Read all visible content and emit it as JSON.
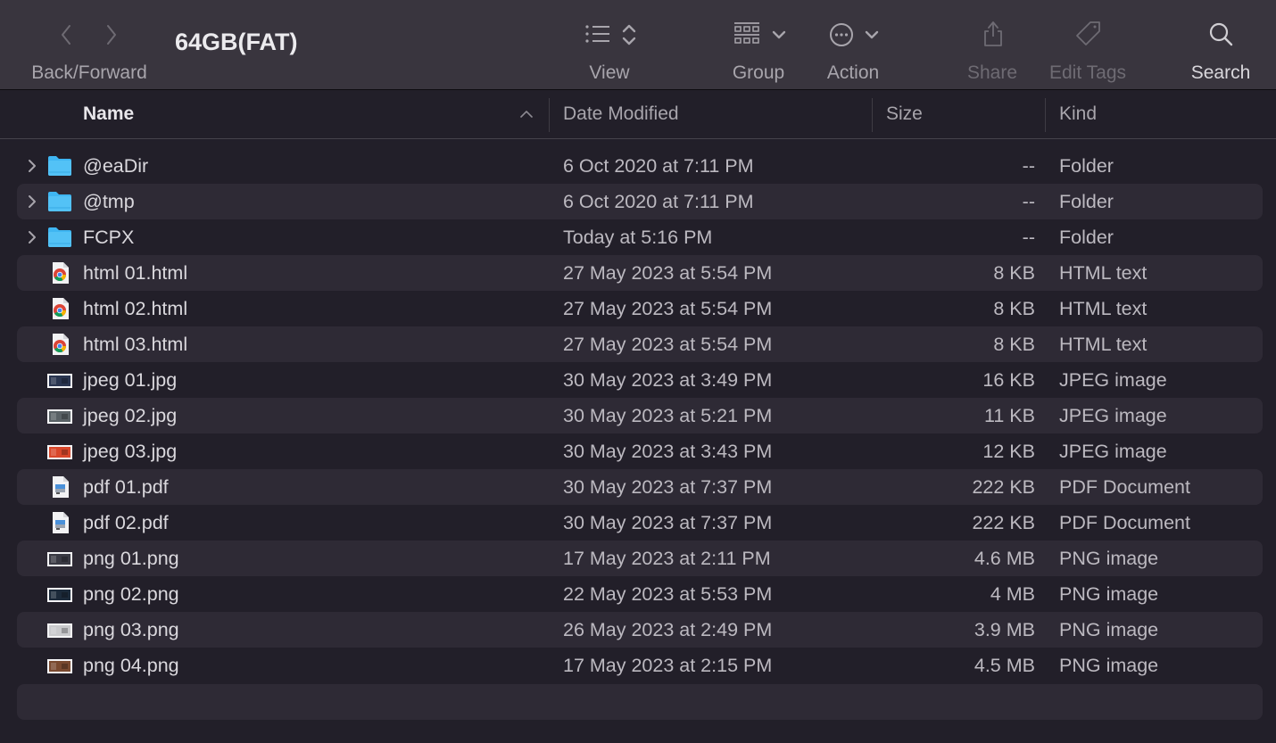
{
  "window": {
    "title": "64GB(FAT)"
  },
  "toolbar": {
    "back_forward_label": "Back/Forward",
    "view_label": "View",
    "group_label": "Group",
    "action_label": "Action",
    "share_label": "Share",
    "edit_tags_label": "Edit Tags",
    "search_label": "Search"
  },
  "columns": {
    "name": "Name",
    "date_modified": "Date Modified",
    "size": "Size",
    "kind": "Kind",
    "sort_indicator": "ascending"
  },
  "files": [
    {
      "name": "@eaDir",
      "date": "6 Oct 2020 at 7:11 PM",
      "size": "--",
      "kind": "Folder",
      "icon": "folder-icon",
      "expandable": true
    },
    {
      "name": "@tmp",
      "date": "6 Oct 2020 at 7:11 PM",
      "size": "--",
      "kind": "Folder",
      "icon": "folder-icon",
      "expandable": true
    },
    {
      "name": "FCPX",
      "date": "Today at 5:16 PM",
      "size": "--",
      "kind": "Folder",
      "icon": "folder-icon",
      "expandable": true
    },
    {
      "name": "html 01.html",
      "date": "27 May 2023 at 5:54 PM",
      "size": "8 KB",
      "kind": "HTML text",
      "icon": "chrome-html-icon",
      "expandable": false
    },
    {
      "name": "html 02.html",
      "date": "27 May 2023 at 5:54 PM",
      "size": "8 KB",
      "kind": "HTML text",
      "icon": "chrome-html-icon",
      "expandable": false
    },
    {
      "name": "html 03.html",
      "date": "27 May 2023 at 5:54 PM",
      "size": "8 KB",
      "kind": "HTML text",
      "icon": "chrome-html-icon",
      "expandable": false
    },
    {
      "name": "jpeg 01.jpg",
      "date": "30 May 2023 at 3:49 PM",
      "size": "16 KB",
      "kind": "JPEG image",
      "icon": "image-thumbnail-icon",
      "thumb": "#2a3550",
      "expandable": false
    },
    {
      "name": "jpeg 02.jpg",
      "date": "30 May 2023 at 5:21 PM",
      "size": "11 KB",
      "kind": "JPEG image",
      "icon": "image-thumbnail-icon",
      "thumb": "#5a6266",
      "expandable": false
    },
    {
      "name": "jpeg 03.jpg",
      "date": "30 May 2023 at 3:43 PM",
      "size": "12 KB",
      "kind": "JPEG image",
      "icon": "image-thumbnail-icon",
      "thumb": "#d9472b",
      "expandable": false
    },
    {
      "name": "pdf 01.pdf",
      "date": "30 May 2023 at 7:37 PM",
      "size": "222 KB",
      "kind": "PDF Document",
      "icon": "pdf-document-icon",
      "expandable": false
    },
    {
      "name": "pdf 02.pdf",
      "date": "30 May 2023 at 7:37 PM",
      "size": "222 KB",
      "kind": "PDF Document",
      "icon": "pdf-document-icon",
      "expandable": false
    },
    {
      "name": "png 01.png",
      "date": "17 May 2023 at 2:11 PM",
      "size": "4.6 MB",
      "kind": "PNG image",
      "icon": "image-thumbnail-icon",
      "thumb": "#3a3a44",
      "expandable": false
    },
    {
      "name": "png 02.png",
      "date": "22 May 2023 at 5:53 PM",
      "size": "4 MB",
      "kind": "PNG image",
      "icon": "image-thumbnail-icon",
      "thumb": "#1c2a3a",
      "expandable": false
    },
    {
      "name": "png 03.png",
      "date": "26 May 2023 at 2:49 PM",
      "size": "3.9 MB",
      "kind": "PNG image",
      "icon": "image-thumbnail-icon",
      "thumb": "#c9c9cc",
      "expandable": false
    },
    {
      "name": "png 04.png",
      "date": "17 May 2023 at 2:15 PM",
      "size": "4.5 MB",
      "kind": "PNG image",
      "icon": "image-thumbnail-icon",
      "thumb": "#7a4a30",
      "expandable": false
    }
  ],
  "colors": {
    "toolbar_bg": "#39353e",
    "list_bg": "#221f29",
    "alt_row_bg": "#2e2a35",
    "folder_blue": "#3fb6f2"
  }
}
